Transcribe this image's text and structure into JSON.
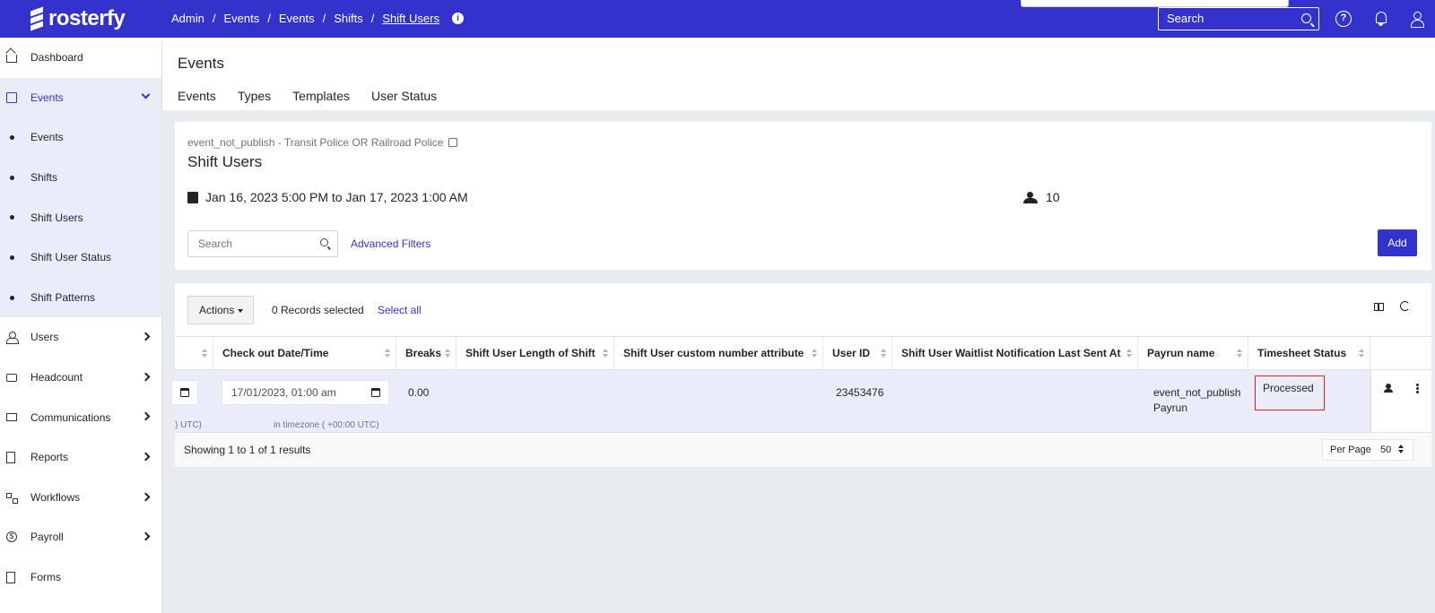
{
  "app": {
    "logo_text": "rosterfy"
  },
  "breadcrumb": [
    "Admin",
    "Events",
    "Events",
    "Shifts",
    "Shift Users"
  ],
  "top_search": {
    "placeholder": "Search"
  },
  "sidebar": {
    "items": [
      {
        "label": "Dashboard",
        "icon": "home-icon"
      },
      {
        "label": "Events",
        "icon": "calendar-icon",
        "expanded": true
      },
      {
        "label": "Users",
        "icon": "users-icon"
      },
      {
        "label": "Headcount",
        "icon": "briefcase-icon"
      },
      {
        "label": "Communications",
        "icon": "mail-icon"
      },
      {
        "label": "Reports",
        "icon": "document-icon"
      },
      {
        "label": "Workflows",
        "icon": "workflow-icon"
      },
      {
        "label": "Payroll",
        "icon": "dollar-icon"
      },
      {
        "label": "Forms",
        "icon": "form-icon"
      }
    ],
    "events_sub": [
      "Events",
      "Shifts",
      "Shift Users",
      "Shift User Status",
      "Shift Patterns"
    ]
  },
  "header": {
    "title": "Events",
    "tabs": [
      "Events",
      "Types",
      "Templates",
      "User Status"
    ]
  },
  "event": {
    "subtitle": "event_not_publish - Transit Police OR Railroad Police",
    "title": "Shift Users",
    "date_range": "Jan 16, 2023 5:00 PM to Jan 17, 2023 1:00 AM",
    "user_count": "10"
  },
  "filters": {
    "search_placeholder": "Search",
    "advanced_label": "Advanced Filters",
    "add_label": "Add"
  },
  "table": {
    "actions_label": "Actions",
    "records_selected": "0 Records selected",
    "select_all": "Select all",
    "columns": [
      "Check out Date/Time",
      "Breaks",
      "Shift User Length of Shift",
      "Shift User custom number attribute",
      "User ID",
      "Shift User Waitlist Notification Last Sent At",
      "Payrun name",
      "Timesheet Status"
    ],
    "row": {
      "partial_tz": ") UTC)",
      "checkout_value": "17/01/2023, 01:00 am",
      "checkout_tz": "in timezone ( +00:00 UTC)",
      "breaks": "0.00",
      "user_id": "23453476",
      "payrun_line1": "event_not_publish",
      "payrun_line2": "Payrun",
      "timesheet_status": "Processed"
    },
    "footer_text": "Showing 1 to 1 of 1 results",
    "per_page_label": "Per Page",
    "per_page_value": "50"
  }
}
